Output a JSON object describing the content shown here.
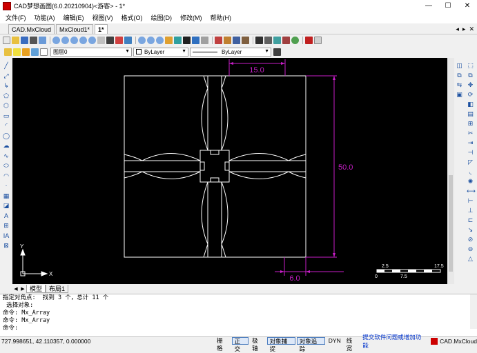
{
  "window": {
    "title": "CAD梦想画图(6.0.20210904)<游客> - 1*",
    "minimize": "—",
    "maximize": "☐",
    "close": "✕"
  },
  "menu": [
    "文件(F)",
    "功能(A)",
    "编辑(E)",
    "视图(V)",
    "格式(O)",
    "绘图(D)",
    "修改(M)",
    "帮助(H)"
  ],
  "tabs": [
    {
      "label": "CAD.MxCloud",
      "active": false
    },
    {
      "label": "MxCloud1*",
      "active": false
    },
    {
      "label": "1*",
      "active": true
    }
  ],
  "tab_controls": [
    "◂",
    "▸",
    "✕"
  ],
  "props": {
    "layer": "图层0",
    "color": "ByLayer",
    "linetype": "ByLayer"
  },
  "drawing": {
    "dim_top": "15.0",
    "dim_right": "50.0",
    "dim_bottom": "6.0",
    "ucs_y": "Y",
    "ucs_x": "X",
    "scale_labels": [
      "2.5",
      "17.5",
      "0",
      "7.5"
    ]
  },
  "layout_tabs": [
    {
      "label": "模型",
      "active": true
    },
    {
      "label": "布局1",
      "active": false
    }
  ],
  "command": {
    "lines": [
      "指定对角点:  找到 3 个，总计 11 个",
      " 选择对象:",
      "命令: Mx_Array",
      "命令: Mx_Array",
      "命令:"
    ]
  },
  "status": {
    "coords": "727.998651, 42.110357, 0.000000",
    "buttons": [
      {
        "label": "栅格",
        "on": false
      },
      {
        "label": "正交",
        "on": true
      },
      {
        "label": "极轴",
        "on": false
      },
      {
        "label": "对象捕捉",
        "on": true
      },
      {
        "label": "对象追踪",
        "on": true
      },
      {
        "label": "DYN",
        "on": false
      },
      {
        "label": "线宽",
        "on": false
      }
    ],
    "link": "提交软件问题或增加功能",
    "brand": "CAD.MxCloud"
  },
  "colors": {
    "dimension": "#c81ec8",
    "geometry": "#ffffff",
    "canvas": "#000000"
  }
}
